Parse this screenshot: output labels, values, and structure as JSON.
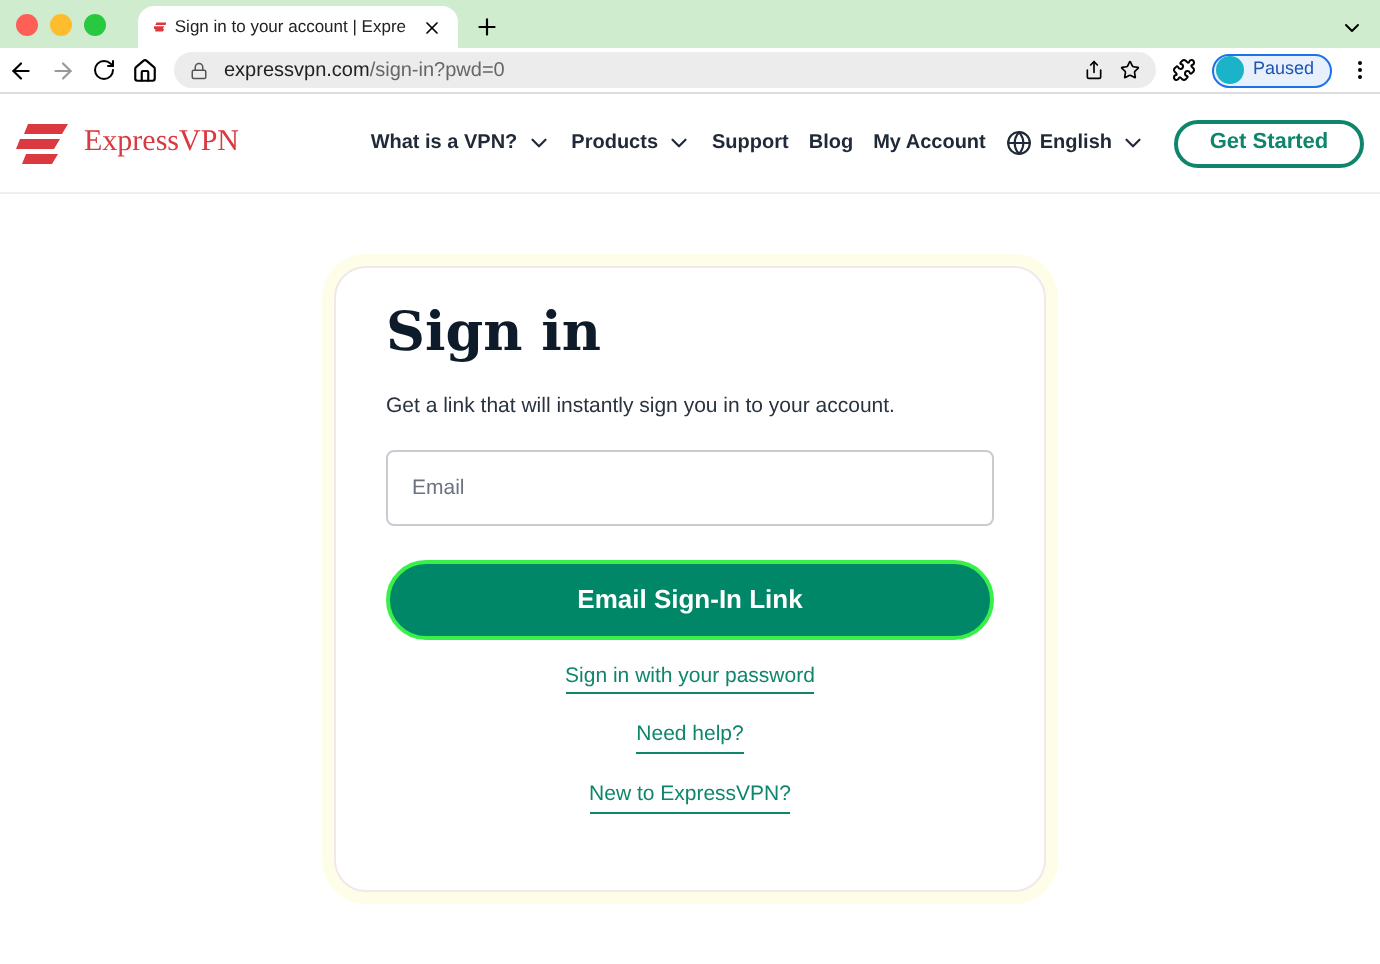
{
  "browser": {
    "tab_title": "Sign in to your account | Expre",
    "url_host": "expressvpn.com",
    "url_path": "/sign-in?pwd=0",
    "profile_status": "Paused"
  },
  "header": {
    "brand": "ExpressVPN",
    "nav": [
      {
        "label": "What is a VPN?",
        "kind": "dropdown"
      },
      {
        "label": "Products",
        "kind": "dropdown"
      },
      {
        "label": "Support",
        "kind": "link"
      },
      {
        "label": "Blog",
        "kind": "link"
      },
      {
        "label": "My Account",
        "kind": "link"
      },
      {
        "label": "English",
        "kind": "language"
      }
    ],
    "cta": "Get Started"
  },
  "sign_in": {
    "title": "Sign in",
    "subtitle": "Get a link that will instantly sign you in to your account.",
    "email_placeholder": "Email",
    "submit": "Email Sign-In Link",
    "links": [
      "Sign in with your password",
      "Need help?",
      "New to ExpressVPN?"
    ]
  }
}
